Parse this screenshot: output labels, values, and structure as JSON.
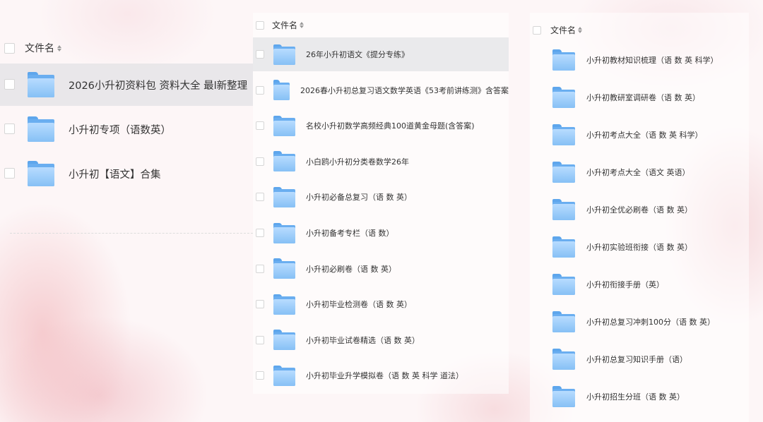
{
  "column_header": "文件名",
  "icons": {
    "folder": "folder-icon",
    "sort": "sort-icon",
    "checkbox": "checkbox"
  },
  "colors": {
    "folder_light": "#bfe0ff",
    "folder_dark": "#5ea6ec",
    "selected_row": "#e4e4e6"
  },
  "panel1": {
    "items": [
      {
        "name": "2026小升初资料包   资料大全  最l新整理",
        "selected": true
      },
      {
        "name": "小升初专项（语数英）",
        "selected": false
      },
      {
        "name": "小升初【语文】合集",
        "selected": false
      }
    ]
  },
  "panel2": {
    "items": [
      {
        "name": "26年小升初语文《提分专练》",
        "selected": true
      },
      {
        "name": "2026春小升初总复习语文数学英语《53考前讲练测》含答案",
        "selected": false
      },
      {
        "name": "名校小升初数学高频经典100道黄金母题(含答案)",
        "selected": false
      },
      {
        "name": "小白鸥小升初分类卷数学26年",
        "selected": false
      },
      {
        "name": "小升初必备总复习（语 数 英）",
        "selected": false
      },
      {
        "name": "小升初备考专栏（语 数）",
        "selected": false
      },
      {
        "name": "小升初必刷卷（语 数 英）",
        "selected": false
      },
      {
        "name": "小升初毕业检测卷（语 数 英）",
        "selected": false
      },
      {
        "name": "小升初毕业试卷精选（语 数 英）",
        "selected": false
      },
      {
        "name": "小升初毕业升学模拟卷（语 数 英 科学 道法）",
        "selected": false
      }
    ]
  },
  "panel3": {
    "items": [
      {
        "name": "小升初教材知识梳理（语 数 英 科学）"
      },
      {
        "name": "小升初教研室调研卷（语 数 英）"
      },
      {
        "name": "小升初考点大全（语 数 英 科学）"
      },
      {
        "name": "小升初考点大全（语文 英语）"
      },
      {
        "name": "小升初全优必刷卷（语 数 英）"
      },
      {
        "name": "小升初实验班衔接（语 数 英）"
      },
      {
        "name": "小升初衔接手册（英）"
      },
      {
        "name": "小升初总复习冲刺100分（语 数 英）"
      },
      {
        "name": "小升初总复习知识手册（语）"
      },
      {
        "name": "小升初招生分班（语 数 英）"
      }
    ]
  }
}
